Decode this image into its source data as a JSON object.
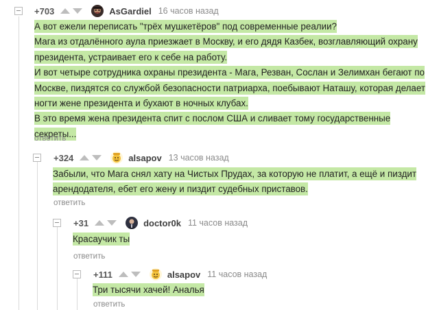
{
  "colors": {
    "highlight": "#c4e8a5",
    "rating": "#555555",
    "author": "#3e3e3e",
    "muted": "#8a8a8a"
  },
  "comments": [
    {
      "rating": "+703",
      "author": "AsGardiel",
      "time": "16 часов назад",
      "avatar_icon": "avatar-dark-face-icon",
      "lines": [
        "А вот ежели переписать \"трёх мушкетёров\" под современные реалии?",
        "Мага из отдалённого аула приезжает в Москву, и его дядя Казбек, возглавляющий охрану",
        "президента, устраивает его к себе на работу.",
        "И вот четыре сотрудника охраны президента - Мага, Резван, Сослан и Зелимхан бегают по",
        "Москве, пиздятся со службой безопасности патриарха, поебывают Наташу, которая делает",
        "ногти жене президента и бухают в ночных клубах.",
        "В это время жена президента спит с послом США и сливает тому государственные",
        "секреты..."
      ],
      "reply_label": "ответить"
    },
    {
      "rating": "+324",
      "author": "alsapov",
      "time": "13 часов назад",
      "avatar_icon": "avatar-yellow-cartoon-icon",
      "lines": [
        "Забыли, что Мага снял хату на Чистых Прудах, за которую не платит, а ещё и пиздит",
        "арендодателя, ебет его жену и пиздит судебных приставов."
      ],
      "reply_label": "ответить"
    },
    {
      "rating": "+31",
      "author": "doctor0k",
      "time": "11 часов назад",
      "avatar_icon": "avatar-person-photo-icon",
      "lines": [
        "Красаучик ты"
      ],
      "reply_label": "ответить"
    },
    {
      "rating": "+111",
      "author": "alsapov",
      "time": "11 часов назад",
      "avatar_icon": "avatar-yellow-cartoon-icon",
      "lines": [
        "Три тысячи хачей! Аналья"
      ],
      "reply_label": "ответить"
    }
  ]
}
